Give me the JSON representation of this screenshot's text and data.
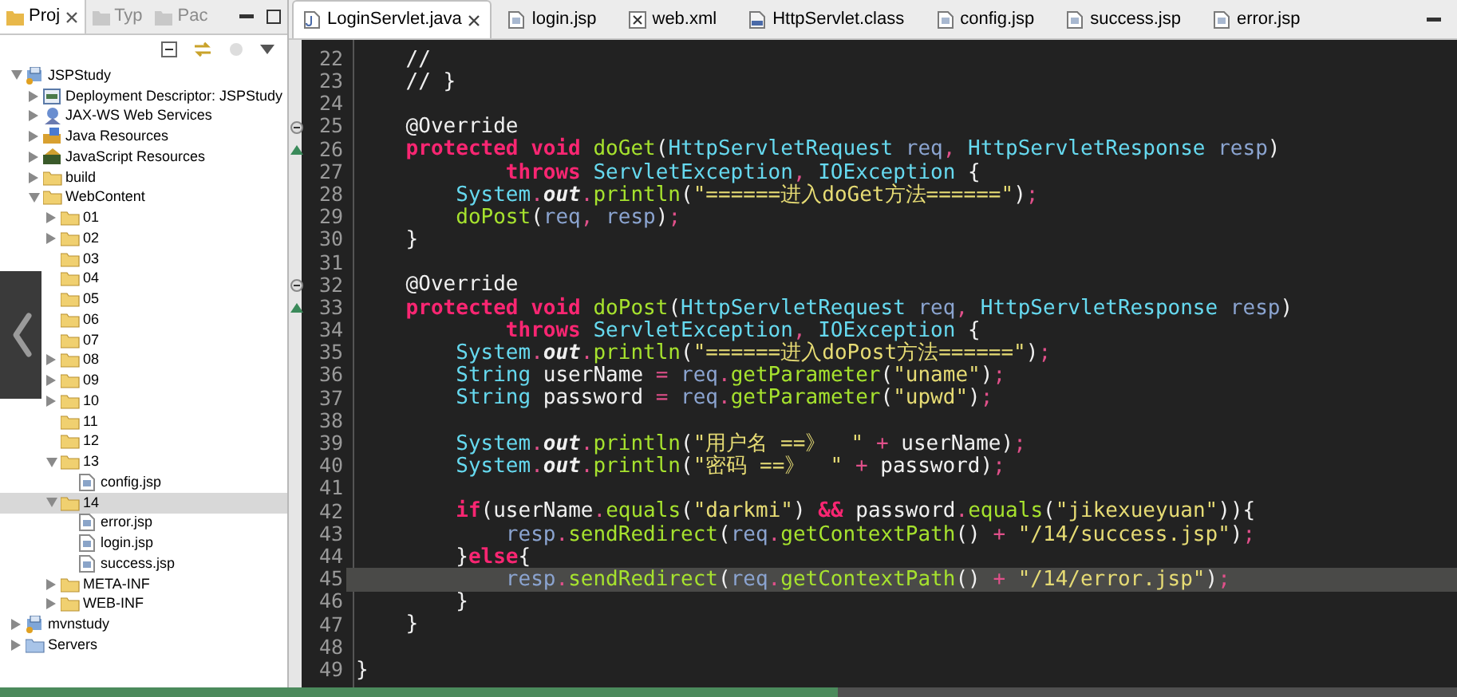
{
  "explorer": {
    "tabs": [
      {
        "label": "Proj",
        "selected": true
      },
      {
        "label": "Typ",
        "selected": false
      },
      {
        "label": "Pac",
        "selected": false
      }
    ],
    "tree": [
      {
        "label": "JSPStudy",
        "kind": "project",
        "expanded": true,
        "selected": false,
        "children": [
          {
            "label": "Deployment Descriptor: JSPStudy",
            "kind": "descriptor",
            "expanded": false,
            "selected": false
          },
          {
            "label": "JAX-WS Web Services",
            "kind": "webservices",
            "expanded": false,
            "selected": false
          },
          {
            "label": "Java Resources",
            "kind": "javares",
            "expanded": false,
            "selected": false
          },
          {
            "label": "JavaScript Resources",
            "kind": "jsres",
            "expanded": false,
            "selected": false
          },
          {
            "label": "build",
            "kind": "folder",
            "expanded": false,
            "selected": false
          },
          {
            "label": "WebContent",
            "kind": "folder",
            "expanded": true,
            "selected": false,
            "children": [
              {
                "label": "01",
                "kind": "folder",
                "expanded": false,
                "selected": false
              },
              {
                "label": "02",
                "kind": "folder",
                "expanded": false,
                "selected": false
              },
              {
                "label": "03",
                "kind": "folder",
                "selected": false
              },
              {
                "label": "04",
                "kind": "folder",
                "selected": false
              },
              {
                "label": "05",
                "kind": "folder",
                "selected": false
              },
              {
                "label": "06",
                "kind": "folder",
                "selected": false
              },
              {
                "label": "07",
                "kind": "folder",
                "selected": false
              },
              {
                "label": "08",
                "kind": "folder",
                "expanded": false,
                "selected": false
              },
              {
                "label": "09",
                "kind": "folder",
                "expanded": false,
                "selected": false
              },
              {
                "label": "10",
                "kind": "folder",
                "expanded": false,
                "selected": false
              },
              {
                "label": "11",
                "kind": "folder",
                "selected": false
              },
              {
                "label": "12",
                "kind": "folder",
                "selected": false
              },
              {
                "label": "13",
                "kind": "folder",
                "expanded": true,
                "selected": false,
                "children": [
                  {
                    "label": "config.jsp",
                    "kind": "file",
                    "selected": false
                  }
                ]
              },
              {
                "label": "14",
                "kind": "folder",
                "expanded": true,
                "selected": true,
                "children": [
                  {
                    "label": "error.jsp",
                    "kind": "file",
                    "selected": false
                  },
                  {
                    "label": "login.jsp",
                    "kind": "file",
                    "selected": false
                  },
                  {
                    "label": "success.jsp",
                    "kind": "file",
                    "selected": false
                  }
                ]
              },
              {
                "label": "META-INF",
                "kind": "folder",
                "expanded": false,
                "selected": false
              },
              {
                "label": "WEB-INF",
                "kind": "folder",
                "expanded": false,
                "selected": false
              }
            ]
          }
        ]
      },
      {
        "label": "mvnstudy",
        "kind": "project",
        "expanded": false,
        "selected": false
      },
      {
        "label": "Servers",
        "kind": "servers",
        "expanded": false,
        "selected": false
      }
    ]
  },
  "editor": {
    "tabs": [
      {
        "label": "LoginServlet.java",
        "kind": "java",
        "selected": true
      },
      {
        "label": "login.jsp",
        "kind": "jsp",
        "selected": false
      },
      {
        "label": "web.xml",
        "kind": "xml",
        "selected": false
      },
      {
        "label": "HttpServlet.class",
        "kind": "class",
        "selected": false
      },
      {
        "label": "config.jsp",
        "kind": "jsp",
        "selected": false
      },
      {
        "label": "success.jsp",
        "kind": "jsp",
        "selected": false
      },
      {
        "label": "error.jsp",
        "kind": "jsp",
        "selected": false
      }
    ],
    "lines": [
      {
        "number": "22",
        "highlighted": false,
        "tokens": [
          {
            "kind": "plain",
            "text": "    //"
          }
        ]
      },
      {
        "number": "23",
        "highlighted": false,
        "tokens": [
          {
            "kind": "plain",
            "text": "    // }"
          }
        ]
      },
      {
        "number": "24",
        "highlighted": false
      },
      {
        "number": "25",
        "highlighted": false,
        "foldable": true,
        "tokens": [
          {
            "kind": "plain",
            "text": "    @Override"
          }
        ]
      },
      {
        "number": "26",
        "highlighted": false,
        "overrides": true,
        "tokens": [
          {
            "kind": "kw",
            "text": "    protected void "
          },
          {
            "kind": "fn",
            "text": "doGet"
          },
          {
            "kind": "plain",
            "text": "("
          },
          {
            "kind": "type",
            "text": "HttpServletRequest"
          },
          {
            "kind": "var",
            "text": " req"
          },
          {
            "kind": "punc",
            "text": ", "
          },
          {
            "kind": "type",
            "text": "HttpServletResponse"
          },
          {
            "kind": "var",
            "text": " resp"
          },
          {
            "kind": "plain",
            "text": ")"
          }
        ]
      },
      {
        "number": "27",
        "highlighted": false,
        "tokens": [
          {
            "kind": "kw",
            "text": "            throws "
          },
          {
            "kind": "type",
            "text": "ServletException"
          },
          {
            "kind": "punc",
            "text": ", "
          },
          {
            "kind": "type",
            "text": "IOException"
          },
          {
            "kind": "plain",
            "text": " {"
          }
        ]
      },
      {
        "number": "28",
        "highlighted": false,
        "tokens": [
          {
            "kind": "type",
            "text": "        System"
          },
          {
            "kind": "punc",
            "text": "."
          },
          {
            "kind": "field",
            "text": "out"
          },
          {
            "kind": "punc",
            "text": "."
          },
          {
            "kind": "fn",
            "text": "println"
          },
          {
            "kind": "plain",
            "text": "("
          },
          {
            "kind": "str",
            "text": "\"======进入doGet方法======\""
          },
          {
            "kind": "plain",
            "text": ")"
          },
          {
            "kind": "punc",
            "text": ";"
          }
        ]
      },
      {
        "number": "29",
        "highlighted": false,
        "tokens": [
          {
            "kind": "fn",
            "text": "        doPost"
          },
          {
            "kind": "plain",
            "text": "("
          },
          {
            "kind": "var",
            "text": "req"
          },
          {
            "kind": "punc",
            "text": ", "
          },
          {
            "kind": "var",
            "text": "resp"
          },
          {
            "kind": "plain",
            "text": ")"
          },
          {
            "kind": "punc",
            "text": ";"
          }
        ]
      },
      {
        "number": "30",
        "highlighted": false,
        "tokens": [
          {
            "kind": "plain",
            "text": "    }"
          }
        ]
      },
      {
        "number": "31",
        "highlighted": false
      },
      {
        "number": "32",
        "highlighted": false,
        "foldable": true,
        "tokens": [
          {
            "kind": "plain",
            "text": "    @Override"
          }
        ]
      },
      {
        "number": "33",
        "highlighted": false,
        "overrides": true,
        "tokens": [
          {
            "kind": "kw",
            "text": "    protected void "
          },
          {
            "kind": "fn",
            "text": "doPost"
          },
          {
            "kind": "plain",
            "text": "("
          },
          {
            "kind": "type",
            "text": "HttpServletRequest"
          },
          {
            "kind": "var",
            "text": " req"
          },
          {
            "kind": "punc",
            "text": ", "
          },
          {
            "kind": "type",
            "text": "HttpServletResponse"
          },
          {
            "kind": "var",
            "text": " resp"
          },
          {
            "kind": "plain",
            "text": ")"
          }
        ]
      },
      {
        "number": "34",
        "highlighted": false,
        "tokens": [
          {
            "kind": "kw",
            "text": "            throws "
          },
          {
            "kind": "type",
            "text": "ServletException"
          },
          {
            "kind": "punc",
            "text": ", "
          },
          {
            "kind": "type",
            "text": "IOException"
          },
          {
            "kind": "plain",
            "text": " {"
          }
        ]
      },
      {
        "number": "35",
        "highlighted": false,
        "tokens": [
          {
            "kind": "type",
            "text": "        System"
          },
          {
            "kind": "punc",
            "text": "."
          },
          {
            "kind": "field",
            "text": "out"
          },
          {
            "kind": "punc",
            "text": "."
          },
          {
            "kind": "fn",
            "text": "println"
          },
          {
            "kind": "plain",
            "text": "("
          },
          {
            "kind": "str",
            "text": "\"======进入doPost方法======\""
          },
          {
            "kind": "plain",
            "text": ")"
          },
          {
            "kind": "punc",
            "text": ";"
          }
        ]
      },
      {
        "number": "36",
        "highlighted": false,
        "tokens": [
          {
            "kind": "type",
            "text": "        String"
          },
          {
            "kind": "plain",
            "text": " userName "
          },
          {
            "kind": "punc",
            "text": "= "
          },
          {
            "kind": "var",
            "text": "req"
          },
          {
            "kind": "punc",
            "text": "."
          },
          {
            "kind": "fn",
            "text": "getParameter"
          },
          {
            "kind": "plain",
            "text": "("
          },
          {
            "kind": "str",
            "text": "\"uname\""
          },
          {
            "kind": "plain",
            "text": ")"
          },
          {
            "kind": "punc",
            "text": ";"
          }
        ]
      },
      {
        "number": "37",
        "highlighted": false,
        "tokens": [
          {
            "kind": "type",
            "text": "        String"
          },
          {
            "kind": "plain",
            "text": " password "
          },
          {
            "kind": "punc",
            "text": "= "
          },
          {
            "kind": "var",
            "text": "req"
          },
          {
            "kind": "punc",
            "text": "."
          },
          {
            "kind": "fn",
            "text": "getParameter"
          },
          {
            "kind": "plain",
            "text": "("
          },
          {
            "kind": "str",
            "text": "\"upwd\""
          },
          {
            "kind": "plain",
            "text": ")"
          },
          {
            "kind": "punc",
            "text": ";"
          }
        ]
      },
      {
        "number": "38",
        "highlighted": false
      },
      {
        "number": "39",
        "highlighted": false,
        "tokens": [
          {
            "kind": "type",
            "text": "        System"
          },
          {
            "kind": "punc",
            "text": "."
          },
          {
            "kind": "field",
            "text": "out"
          },
          {
            "kind": "punc",
            "text": "."
          },
          {
            "kind": "fn",
            "text": "println"
          },
          {
            "kind": "plain",
            "text": "("
          },
          {
            "kind": "str",
            "text": "\"用户名 ==》  \""
          },
          {
            "kind": "punc",
            "text": " + "
          },
          {
            "kind": "plain",
            "text": "userName)"
          },
          {
            "kind": "punc",
            "text": ";"
          }
        ]
      },
      {
        "number": "40",
        "highlighted": false,
        "tokens": [
          {
            "kind": "type",
            "text": "        System"
          },
          {
            "kind": "punc",
            "text": "."
          },
          {
            "kind": "field",
            "text": "out"
          },
          {
            "kind": "punc",
            "text": "."
          },
          {
            "kind": "fn",
            "text": "println"
          },
          {
            "kind": "plain",
            "text": "("
          },
          {
            "kind": "str",
            "text": "\"密码 ==》  \""
          },
          {
            "kind": "punc",
            "text": " + "
          },
          {
            "kind": "plain",
            "text": "password)"
          },
          {
            "kind": "punc",
            "text": ";"
          }
        ]
      },
      {
        "number": "41",
        "highlighted": false
      },
      {
        "number": "42",
        "highlighted": false,
        "tokens": [
          {
            "kind": "kw",
            "text": "        if"
          },
          {
            "kind": "plain",
            "text": "(userName"
          },
          {
            "kind": "punc",
            "text": "."
          },
          {
            "kind": "fn",
            "text": "equals"
          },
          {
            "kind": "plain",
            "text": "("
          },
          {
            "kind": "str",
            "text": "\"darkmi\""
          },
          {
            "kind": "plain",
            "text": ") "
          },
          {
            "kind": "kw",
            "text": "&&"
          },
          {
            "kind": "plain",
            "text": " password"
          },
          {
            "kind": "punc",
            "text": "."
          },
          {
            "kind": "fn",
            "text": "equals"
          },
          {
            "kind": "plain",
            "text": "("
          },
          {
            "kind": "str",
            "text": "\"jikexueyuan\""
          },
          {
            "kind": "plain",
            "text": ")){"
          }
        ]
      },
      {
        "number": "43",
        "highlighted": false,
        "tokens": [
          {
            "kind": "var",
            "text": "            resp"
          },
          {
            "kind": "punc",
            "text": "."
          },
          {
            "kind": "fn",
            "text": "sendRedirect"
          },
          {
            "kind": "plain",
            "text": "("
          },
          {
            "kind": "var",
            "text": "req"
          },
          {
            "kind": "punc",
            "text": "."
          },
          {
            "kind": "fn",
            "text": "getContextPath"
          },
          {
            "kind": "plain",
            "text": "() "
          },
          {
            "kind": "punc",
            "text": "+ "
          },
          {
            "kind": "str",
            "text": "\"/14/success.jsp\""
          },
          {
            "kind": "plain",
            "text": ")"
          },
          {
            "kind": "punc",
            "text": ";"
          }
        ]
      },
      {
        "number": "44",
        "highlighted": false,
        "tokens": [
          {
            "kind": "plain",
            "text": "        }"
          },
          {
            "kind": "kw",
            "text": "else"
          },
          {
            "kind": "plain",
            "text": "{"
          }
        ]
      },
      {
        "number": "45",
        "highlighted": true,
        "tokens": [
          {
            "kind": "var",
            "text": "            resp"
          },
          {
            "kind": "punc",
            "text": "."
          },
          {
            "kind": "fn",
            "text": "sendRedirect"
          },
          {
            "kind": "plain",
            "text": "("
          },
          {
            "kind": "var",
            "text": "req"
          },
          {
            "kind": "punc",
            "text": "."
          },
          {
            "kind": "fn",
            "text": "getContextPath"
          },
          {
            "kind": "plain",
            "text": "() "
          },
          {
            "kind": "punc",
            "text": "+ "
          },
          {
            "kind": "str",
            "text": "\"/14/error.jsp\""
          },
          {
            "kind": "plain",
            "text": ")"
          },
          {
            "kind": "punc",
            "text": ";"
          }
        ]
      },
      {
        "number": "46",
        "highlighted": false,
        "tokens": [
          {
            "kind": "plain",
            "text": "        }"
          }
        ]
      },
      {
        "number": "47",
        "highlighted": false,
        "tokens": [
          {
            "kind": "plain",
            "text": "    }"
          }
        ]
      },
      {
        "number": "48",
        "highlighted": false
      },
      {
        "number": "49",
        "highlighted": false,
        "tokens": [
          {
            "kind": "plain",
            "text": "}"
          }
        ]
      }
    ]
  },
  "video": {
    "progress": {
      "level": 0.575
    }
  }
}
